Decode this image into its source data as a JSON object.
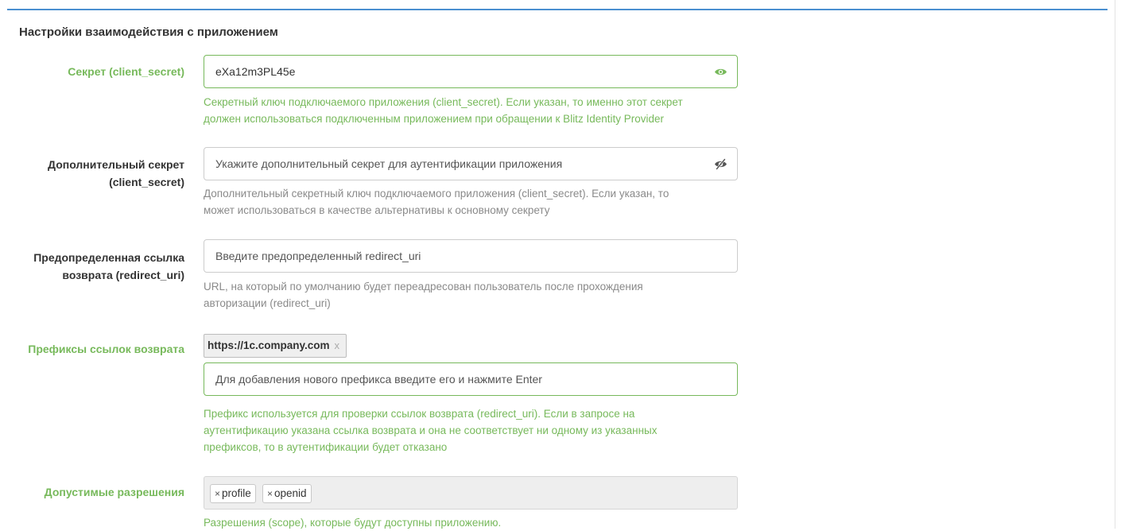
{
  "section": {
    "title": "Настройки взаимодействия с приложением"
  },
  "fields": {
    "secret": {
      "label": "Секрет (client_secret)",
      "value": "eXa12m3PL45e",
      "visibility_icon": "eye-icon",
      "help": [
        "Секретный ключ подключаемого приложения (client_secret). Если указан, то именно этот секрет",
        "должен использоваться подключенным приложением при обращении к Blitz Identity Provider"
      ]
    },
    "extra_secret": {
      "label_lines": [
        "Дополнительный секрет",
        "(client_secret)"
      ],
      "placeholder": "Укажите дополнительный секрет для аутентификации приложения",
      "visibility_icon": "eye-slash-icon",
      "help": [
        "Дополнительный секретный ключ подключаемого приложения (client_secret). Если указан, то",
        "может использоваться в качестве альтернативы к основному секрету"
      ]
    },
    "redirect_uri": {
      "label_lines": [
        "Предопределенная ссылка",
        "возврата (redirect_uri)"
      ],
      "placeholder": "Введите предопределенный redirect_uri",
      "help": [
        "URL, на который по умолчанию будет переадресован пользователь после прохождения",
        "авторизации (redirect_uri)"
      ]
    },
    "prefixes": {
      "label": "Префиксы ссылок возврата",
      "tags": [
        {
          "text": "https://1c.company.com",
          "remove": "x"
        }
      ],
      "placeholder": "Для добавления нового префикса введите его и нажмите Enter",
      "help": [
        "Префикс используется для проверки ссылок возврата (redirect_uri). Если в запросе на",
        "аутентификацию указана ссылка возврата и она не соответствует ни одному из указанных",
        "префиксов, то в аутентификации будет отказано"
      ]
    },
    "scopes": {
      "label": "Допустимые разрешения",
      "chips": [
        {
          "remove": "×",
          "text": "profile"
        },
        {
          "remove": "×",
          "text": "openid"
        }
      ],
      "help": [
        "Разрешения (scope), которые будут доступны приложению."
      ]
    }
  },
  "colors": {
    "success": "#77b95b",
    "accent_rule": "#4a8fd0",
    "muted": "#8a8a8a",
    "border": "#cccccc"
  }
}
